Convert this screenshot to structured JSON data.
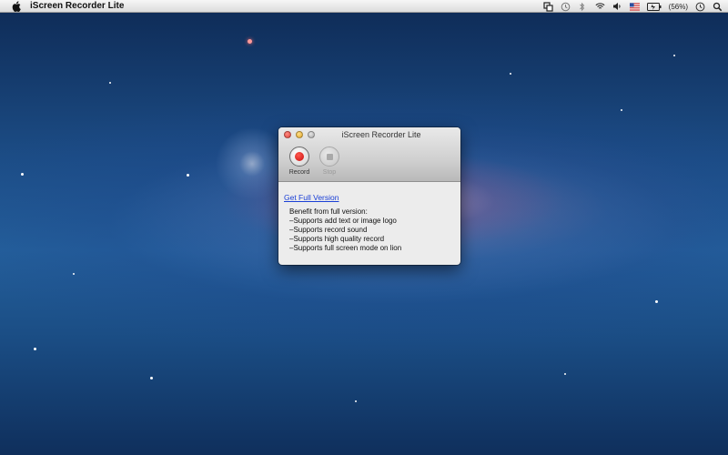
{
  "menubar": {
    "app_name": "iScreen Recorder Lite",
    "battery_percent": "(56%)",
    "icons": [
      "apple-icon",
      "screen-recorder-icon",
      "time-machine-icon",
      "bluetooth-icon",
      "wifi-icon",
      "volume-icon",
      "flag-us-icon",
      "battery-icon",
      "clock-icon",
      "spotlight-icon"
    ]
  },
  "window": {
    "title": "iScreen Recorder Lite",
    "toolbar": {
      "record_label": "Record",
      "stop_label": "Stop"
    },
    "link_text": "Get Full Version",
    "benefits_heading": "Benefit from full version:",
    "benefits": [
      "–Supports add text or image logo",
      "–Supports record sound",
      "–Supports high quality record",
      "–Supports full screen mode on lion"
    ]
  },
  "colors": {
    "link": "#1a3fd6",
    "record_red": "#c80d0d"
  }
}
